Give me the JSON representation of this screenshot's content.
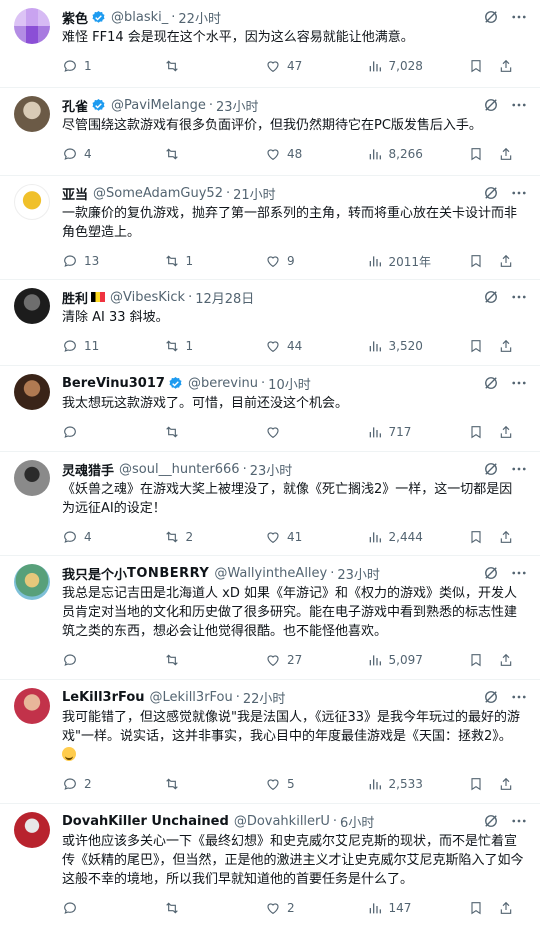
{
  "tweets": [
    {
      "name": "紫色",
      "verified": true,
      "handle": "@blaski_",
      "dot": "·",
      "time": "22小时",
      "text": "难怪 FF14 会是现在这个水平，因为这么容易就能让他满意。",
      "replies": "1",
      "retweets": "",
      "likes": "47",
      "views": "7,028"
    },
    {
      "name": "孔雀",
      "verified": true,
      "handle": "@PaviMelange",
      "dot": "·",
      "time": "23小时",
      "text": "尽管围绕这款游戏有很多负面评价，但我仍然期待它在PC版发售后入手。",
      "replies": "4",
      "retweets": "",
      "likes": "48",
      "views": "8,266"
    },
    {
      "name": "亚当",
      "verified": false,
      "handle": "@SomeAdamGuy52",
      "dot": "·",
      "time": "21小时",
      "text": "一款廉价的复仇游戏，抛弃了第一部系列的主角，转而将重心放在关卡设计而非角色塑造上。",
      "replies": "13",
      "retweets": "1",
      "likes": "9",
      "views": "2011年"
    },
    {
      "name": "胜利",
      "verified": false,
      "flag": true,
      "handle": "@VibesKick",
      "dot": "·",
      "time": "12月28日",
      "text": "清除 AI 33 斜坡。",
      "replies": "11",
      "retweets": "1",
      "likes": "44",
      "views": "3,520"
    },
    {
      "name": "BereVinu3017",
      "verified": true,
      "handle": "@berevinu",
      "dot": "·",
      "time": "10小时",
      "text": "我太想玩这款游戏了。可惜，目前还没这个机会。",
      "replies": "",
      "retweets": "",
      "likes": "",
      "views": "717"
    },
    {
      "name": "灵魂猎手",
      "verified": false,
      "handle": "@soul__hunter666",
      "dot": "·",
      "time": "23小时",
      "text": "《妖兽之魂》在游戏大奖上被埋没了，就像《死亡搁浅2》一样，这一切都是因为远征AI的设定！",
      "replies": "4",
      "retweets": "2",
      "likes": "41",
      "views": "2,444"
    },
    {
      "name": "我只是个小",
      "name_deco": "TONBERRY",
      "verified": false,
      "handle": "@WallyintheAlley",
      "dot": "·",
      "time": "23小时",
      "text": "我总是忘记吉田是北海道人 xD 如果《年游记》和《权力的游戏》类似，开发人员肯定对当地的文化和历史做了很多研究。能在电子游戏中看到熟悉的标志性建筑之类的东西，想必会让他觉得很酷。也不能怪他喜欢。",
      "replies": "",
      "retweets": "",
      "likes": "27",
      "views": "5,097"
    },
    {
      "name": "LeKill3rFou",
      "verified": false,
      "handle": "@Lekill3rFou",
      "dot": "·",
      "time": "22小时",
      "text": "我可能错了，但这感觉就像说\"我是法国人，《远征33》是我今年玩过的最好的游戏\"一样。说实话，这并非事实，我心目中的年度最佳游戏是《天国：拯救2》。",
      "replies": "2",
      "retweets": "",
      "likes": "5",
      "views": "2,533"
    },
    {
      "name": "DovahKiller Unchained",
      "verified": false,
      "handle": "@DovahkillerU",
      "dot": "·",
      "time": "6小时",
      "text": "或许他应该多关心一下《最终幻想》和史克威尔艾尼克斯的现状，而不是忙着宣传《妖精的尾巴》，但当然，正是他的激进主义才让史克威尔艾尼克斯陷入了如今这般不幸的境地，所以我们早就知道他的首要任务是什么了。",
      "replies": "",
      "retweets": "",
      "likes": "2",
      "views": "147"
    }
  ],
  "icons": {
    "verified_color": "#1d9bf0",
    "icon_color": "#536471"
  }
}
